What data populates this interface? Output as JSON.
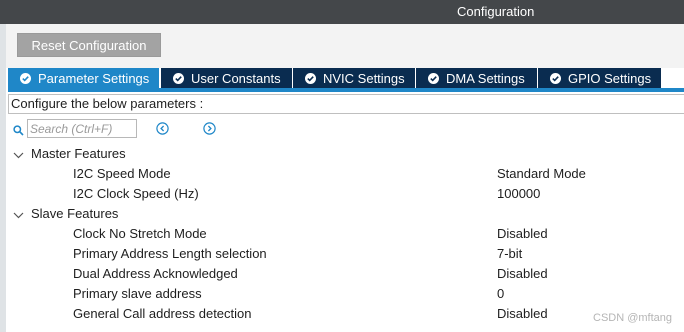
{
  "window": {
    "title": "Configuration"
  },
  "toolbar": {
    "reset_label": "Reset Configuration"
  },
  "tabs": [
    {
      "label": "Parameter Settings",
      "active": true,
      "icon": "check-circle-icon"
    },
    {
      "label": "User Constants",
      "active": false,
      "icon": "check-circle-icon"
    },
    {
      "label": "NVIC Settings",
      "active": false,
      "icon": "check-circle-icon"
    },
    {
      "label": "DMA Settings",
      "active": false,
      "icon": "check-circle-icon"
    },
    {
      "label": "GPIO Settings",
      "active": false,
      "icon": "check-circle-icon"
    }
  ],
  "description": "Configure the below parameters :",
  "search": {
    "placeholder": "Search (Ctrl+F)",
    "value": ""
  },
  "groups": [
    {
      "label": "Master Features",
      "expanded": true,
      "params": [
        {
          "label": "I2C Speed Mode",
          "value": "Standard Mode"
        },
        {
          "label": "I2C Clock Speed (Hz)",
          "value": "100000"
        }
      ]
    },
    {
      "label": "Slave Features",
      "expanded": true,
      "params": [
        {
          "label": "Clock No Stretch Mode",
          "value": "Disabled"
        },
        {
          "label": "Primary Address Length selection",
          "value": "7-bit"
        },
        {
          "label": "Dual Address Acknowledged",
          "value": "Disabled"
        },
        {
          "label": "Primary slave address",
          "value": "0"
        },
        {
          "label": "General Call address detection",
          "value": "Disabled"
        }
      ]
    }
  ],
  "watermark": "CSDN @mftang",
  "colors": {
    "title_bar": "#44474a",
    "tab_inactive": "#0a2c50",
    "tab_active": "#1f87c8",
    "reset_button": "#a3a3a3",
    "accent": "#1f87c8"
  }
}
